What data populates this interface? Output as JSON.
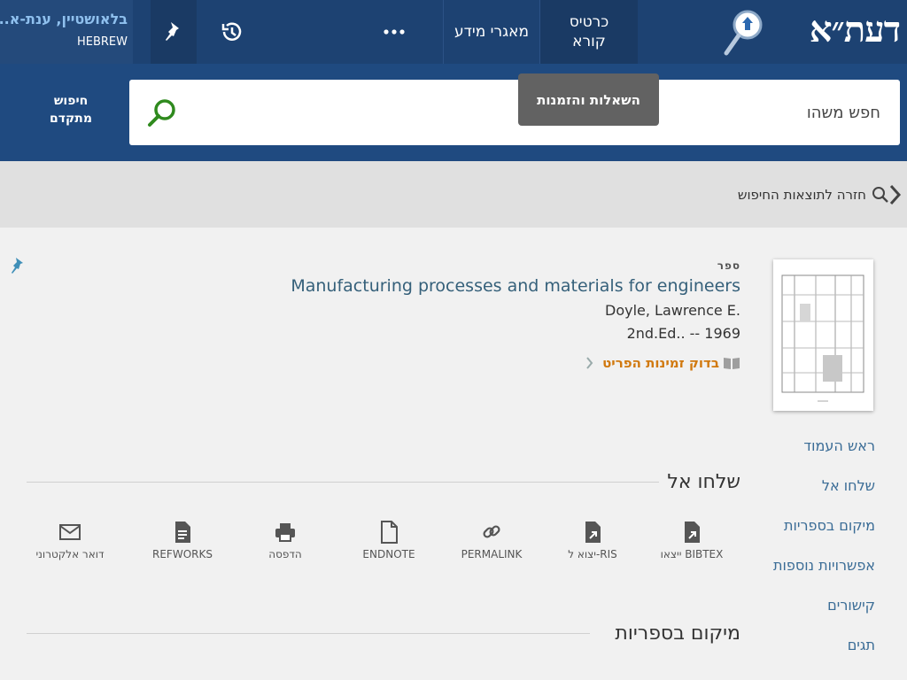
{
  "header": {
    "logo": "דעת״א",
    "tabs": [
      {
        "label": "כרטיס\nקורא"
      },
      {
        "label": "מאגרי מידע"
      }
    ],
    "user": {
      "name": "בלאושטיין, ענת-א...",
      "language": "HEBREW"
    },
    "icons": [
      "more-icon",
      "history-icon",
      "pin-icon",
      "logo-lens-icon"
    ]
  },
  "search": {
    "placeholder": "חפש משהו",
    "advanced_label": "חיפוש\nמתקדם"
  },
  "tooltip": "השאלות והזמנות",
  "back": {
    "label": "חזרה לתוצאות החיפוש"
  },
  "record": {
    "type": "ספר",
    "title": "Manufacturing processes and materials for engineers",
    "author": "Doyle, Lawrence E.",
    "edition": "2nd.Ed.. -- 1969",
    "availability": "בדוק זמינות הפריט"
  },
  "sidenav": [
    "ראש העמוד",
    "שלחו אל",
    "מיקום בספריות",
    "אפשרויות נוספות",
    "קישורים",
    "תגים"
  ],
  "send_to": {
    "title": "שלחו אל",
    "actions": [
      {
        "label": "ייצאו BIBTEX",
        "icon": "export-file-icon"
      },
      {
        "label": "יצוא ל-RIS",
        "icon": "export-file-icon"
      },
      {
        "label": "PERMALINK",
        "icon": "link-icon"
      },
      {
        "label": "ENDNOTE",
        "icon": "document-icon"
      },
      {
        "label": "הדפסה",
        "icon": "printer-icon"
      },
      {
        "label": "REFWORKS",
        "icon": "refworks-icon"
      },
      {
        "label": "דואר אלקטרוני",
        "icon": "mail-icon"
      }
    ]
  },
  "locations": {
    "title": "מיקום בספריות"
  },
  "colors": {
    "topbar": "#1d4272",
    "search_band": "#1f4a80",
    "title_link": "#35607a",
    "availability": "#d1790f",
    "side_link": "#3a6c96",
    "user_name": "#8fc0ee"
  }
}
